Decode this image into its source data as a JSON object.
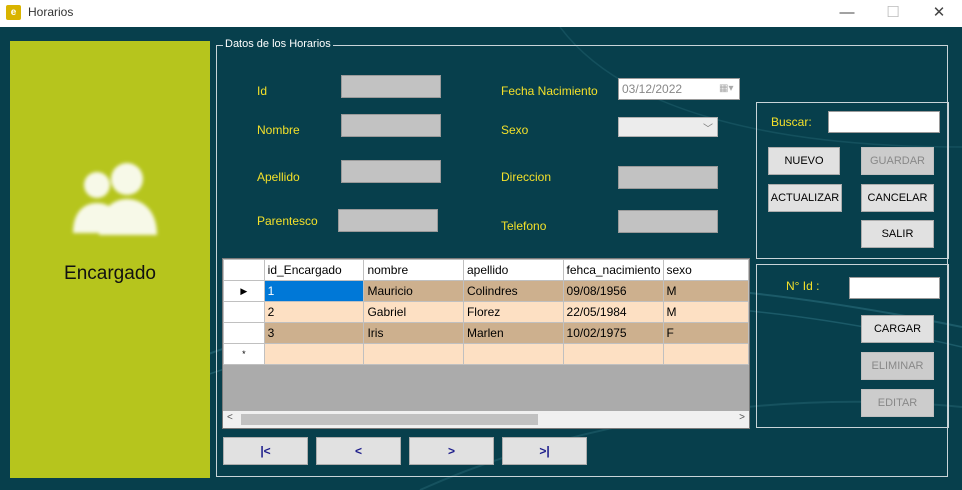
{
  "window": {
    "title": "Horarios",
    "icon_glyph": "e",
    "min_glyph": "—",
    "max_glyph": "☐",
    "close_glyph": "✕"
  },
  "left_panel": {
    "label": "Encargado",
    "icon": "users-icon",
    "color": "#b6c51d"
  },
  "group_title": "Datos de los Horarios",
  "fields": {
    "id_label": "Id",
    "nombre_label": "Nombre",
    "apellido_label": "Apellido",
    "parentesco_label": "Parentesco",
    "fecha_label": "Fecha Nacimiento",
    "fecha_value": "03/12/2022",
    "sexo_label": "Sexo",
    "direccion_label": "Direccion",
    "telefono_label": "Telefono"
  },
  "search": {
    "label": "Buscar:",
    "value": ""
  },
  "buttons": {
    "nuevo": "NUEVO",
    "guardar": "GUARDAR",
    "actualizar": "ACTUALIZAR",
    "cancelar": "CANCELAR",
    "salir": "SALIR",
    "cargar": "CARGAR",
    "eliminar": "ELIMINAR",
    "editar": "EDITAR"
  },
  "id_lookup": {
    "label": "N° Id   :",
    "value": ""
  },
  "grid": {
    "columns": [
      "id_Encargado",
      "nombre",
      "apellido",
      "fehca_nacimiento",
      "sexo"
    ],
    "rows": [
      [
        "1",
        "Mauricio",
        "Colindres",
        "09/08/1956",
        "M"
      ],
      [
        "2",
        "Gabriel",
        "Florez",
        "22/05/1984",
        "M"
      ],
      [
        "3",
        "Iris",
        "Marlen",
        "10/02/1975",
        "F"
      ]
    ],
    "current_row_glyph": "▶",
    "new_row_glyph": "*",
    "scroll_left_glyph": "<",
    "scroll_right_glyph": ">"
  },
  "nav": {
    "first": "|<",
    "prev": "<",
    "next": ">",
    "last": ">|"
  },
  "colors": {
    "background": "#073f4c",
    "label_yellow": "#f3e02a",
    "row_dark": "#cdb08e",
    "row_light": "#fde0c3",
    "selection": "#0078d7"
  }
}
